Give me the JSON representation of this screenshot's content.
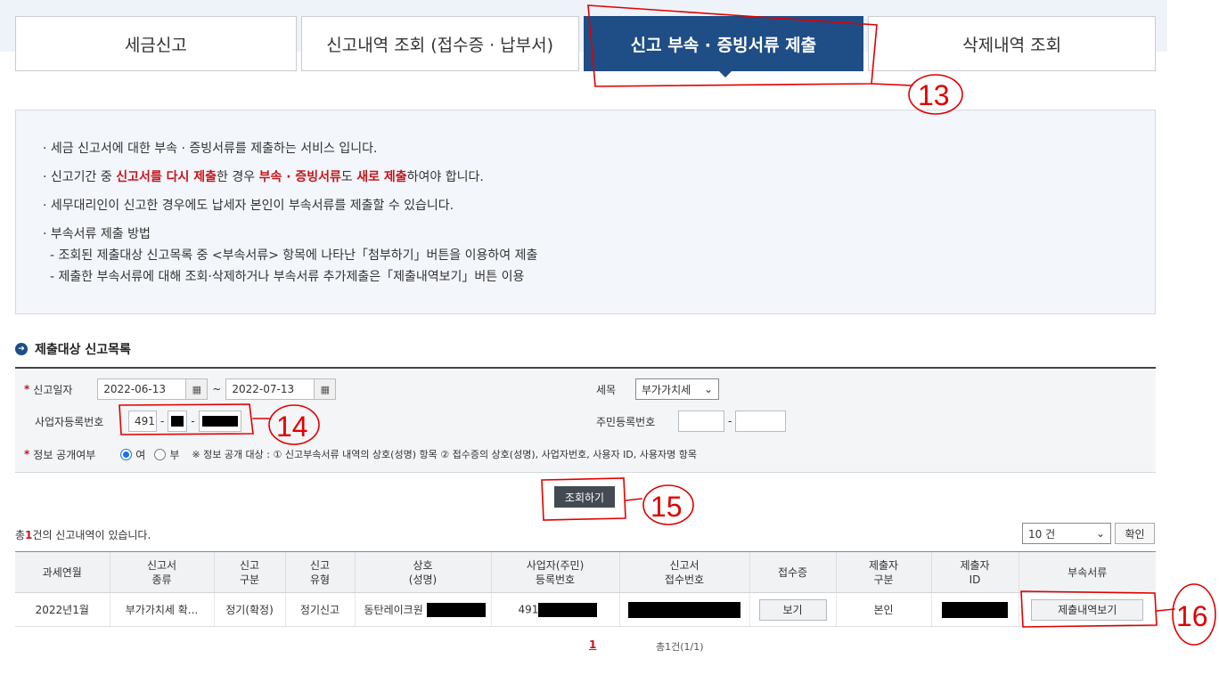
{
  "tabs": [
    {
      "label": "세금신고"
    },
    {
      "label": "신고내역 조회 (접수증 · 납부서)"
    },
    {
      "label": "신고 부속 · 증빙서류 제출"
    },
    {
      "label": "삭제내역 조회"
    }
  ],
  "info": {
    "line1": "세금 신고서에 대한 부속 · 증빙서류를 제출하는 서비스 입니다.",
    "line2_pre": "신고기간 중 ",
    "line2_red1": "신고서를 다시 제출",
    "line2_mid": "한 경우 ",
    "line2_red2": "부속 · 증빙서류",
    "line2_mid2": "도 ",
    "line2_red3": "새로 제출",
    "line2_post": "하여야 합니다.",
    "line3": "세무대리인이 신고한 경우에도 납세자 본인이 부속서류를 제출할 수 있습니다.",
    "line4": "부속서류 제출 방법",
    "line5": "- 조회된 제출대상 신고목록 중 <부속서류> 항목에 나타난「첨부하기」버튼을 이용하여 제출",
    "line6": "- 제출한 부속서류에 대해 조회·삭제하거나 부속서류 추가제출은「제출내역보기」버튼 이용"
  },
  "section_title": "제출대상 신고목록",
  "search": {
    "date_label": "신고일자",
    "date_from": "2022-06-13",
    "date_to": "2022-07-13",
    "tilde": "~",
    "tax_label": "세목",
    "tax_value": "부가가치세",
    "bizno_label": "사업자등록번호",
    "bizno_part1": "491",
    "dash": "-",
    "resident_label": "주민등록번호",
    "disclosure_label": "정보 공개여부",
    "yes": "여",
    "no": "부",
    "disclosure_note": "※ 정보 공개 대상 : ① 신고부속서류 내역의 상호(성명) 항목 ② 접수증의 상호(성명), 사업자번호, 사용자 ID, 사용자명 항목",
    "search_button": "조회하기"
  },
  "result": {
    "count_pre": "총",
    "count_num": "1",
    "count_post": "건의 신고내역이 있습니다.",
    "page_size": "10 건",
    "confirm": "확인"
  },
  "table": {
    "headers": [
      [
        "과세연월",
        ""
      ],
      [
        "신고서",
        "종류"
      ],
      [
        "신고",
        "구분"
      ],
      [
        "신고",
        "유형"
      ],
      [
        "상호",
        "(성명)"
      ],
      [
        "사업자(주민)",
        "등록번호"
      ],
      [
        "신고서",
        "접수번호"
      ],
      [
        "접수증",
        ""
      ],
      [
        "제출자",
        "구분"
      ],
      [
        "제출자",
        "ID"
      ],
      [
        "부속서류",
        ""
      ]
    ],
    "row": {
      "period": "2022년1월",
      "type": "부가가치세 확...",
      "division": "정기(확정)",
      "kind": "정기신고",
      "company": "동탄레이크원",
      "regno": "491",
      "receipt_button": "보기",
      "submitter_type": "본인",
      "attach_button": "제출내역보기"
    }
  },
  "pagination": {
    "current": "1",
    "total": "총1건(1/1)"
  },
  "annotations": {
    "a13": "13",
    "a14": "14",
    "a15": "15",
    "a16": "16"
  },
  "colors": {
    "active_tab": "#1f4d86",
    "highlight_red": "#c4161c",
    "annotation_red": "#e00000"
  }
}
